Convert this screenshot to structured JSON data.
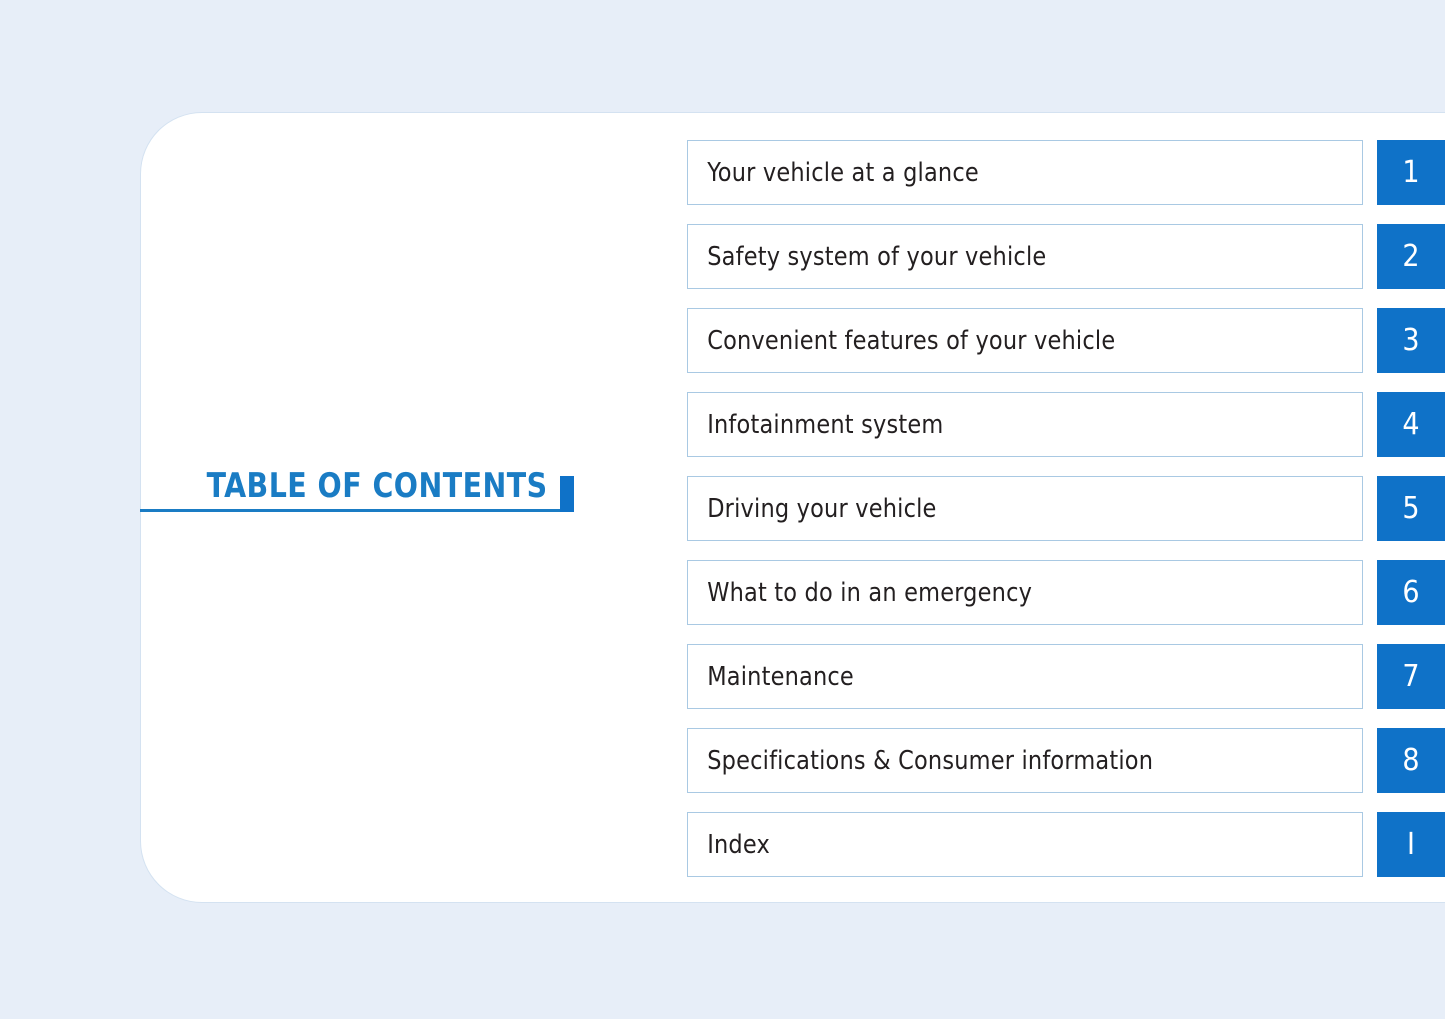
{
  "page": {
    "background_color": "#e7eef8",
    "card_background_color": "#ffffff",
    "accent_color": "#0f72c8",
    "title_color": "#1a7cc4",
    "row_border_color": "#a9c9e3",
    "row_text_color": "#231f20"
  },
  "title": {
    "text": "TABLE OF CONTENTS"
  },
  "contents": {
    "rows": [
      {
        "label": "Your vehicle at a glance",
        "tab": "1"
      },
      {
        "label": "Safety system of your vehicle",
        "tab": "2"
      },
      {
        "label": "Convenient features of your vehicle",
        "tab": "3"
      },
      {
        "label": "Infotainment system",
        "tab": "4"
      },
      {
        "label": "Driving your vehicle",
        "tab": "5"
      },
      {
        "label": "What to do in an emergency",
        "tab": "6"
      },
      {
        "label": "Maintenance",
        "tab": "7"
      },
      {
        "label": "Specifications & Consumer information",
        "tab": "8"
      },
      {
        "label": "Index",
        "tab": "I"
      }
    ]
  }
}
